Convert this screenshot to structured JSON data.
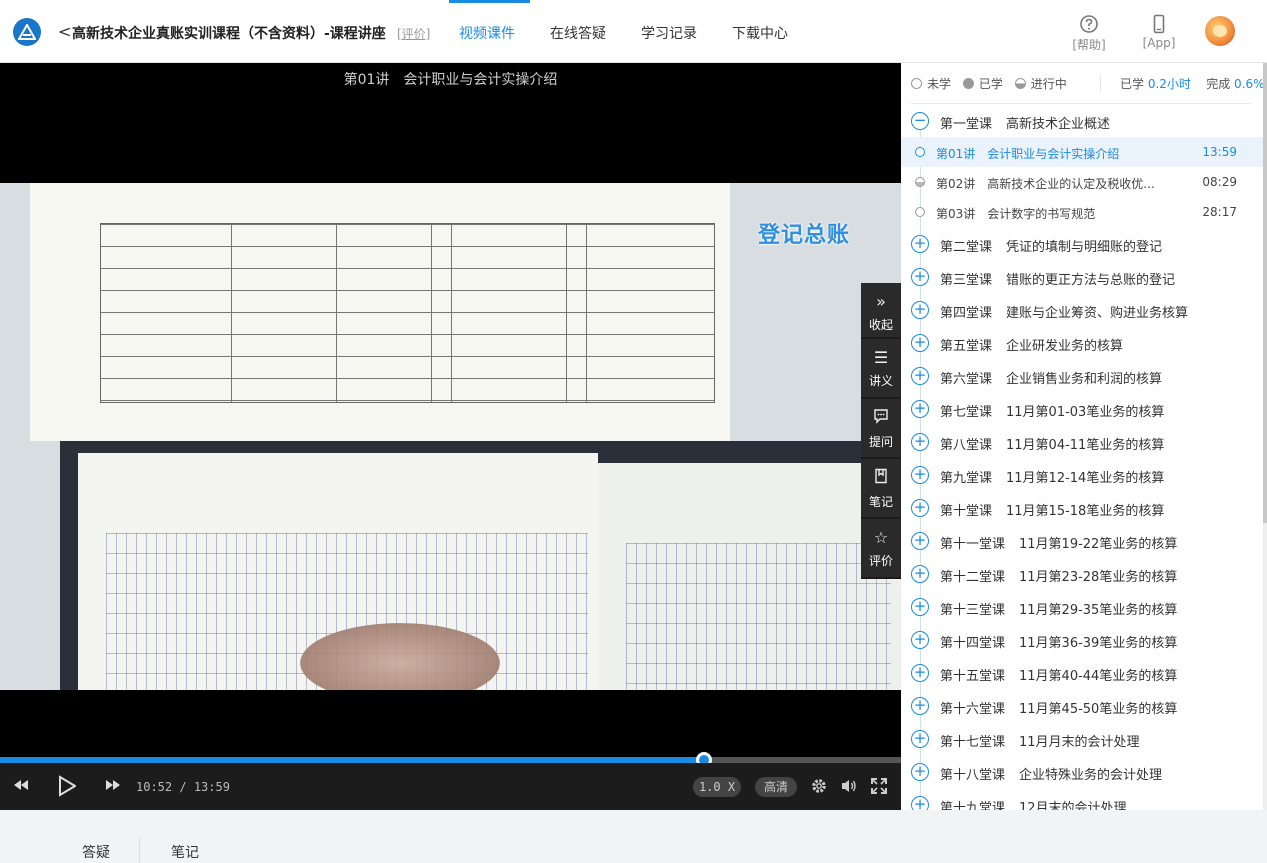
{
  "header": {
    "back_glyph": "<",
    "course_title": "高新技术企业真账实训课程（不含资料）-课程讲座",
    "review_link": "[评价]",
    "nav_tabs": [
      "视频课件",
      "在线答疑",
      "学习记录",
      "下载中心"
    ],
    "active_tab": "视频课件",
    "help_label": "[帮助]",
    "app_label": "[App]",
    "accent_color": "#1a8be3"
  },
  "player": {
    "lecture_title": "第01讲　会计职业与会计实操介绍",
    "overlay_caption": "登记总账",
    "current_time": "10:52",
    "time_separator": "/",
    "total_time": "13:59",
    "progress_fraction": 0.7812,
    "speed": "1.0 X",
    "quality": "高清"
  },
  "tools": [
    "收起",
    "讲义",
    "提问",
    "笔记",
    "评价"
  ],
  "panel": {
    "legend": [
      "未学",
      "已学",
      "进行中"
    ],
    "studied_label": "已学",
    "studied_value": "0.2小时",
    "complete_label": "完成",
    "complete_value": "0.6%",
    "chapters": [
      {
        "num": "第一堂课",
        "title": "高新技术企业概述",
        "expanded": true
      },
      {
        "num": "第二堂课",
        "title": "凭证的填制与明细账的登记"
      },
      {
        "num": "第三堂课",
        "title": "错账的更正方法与总账的登记"
      },
      {
        "num": "第四堂课",
        "title": "建账与企业筹资、购进业务核算"
      },
      {
        "num": "第五堂课",
        "title": "企业研发业务的核算"
      },
      {
        "num": "第六堂课",
        "title": "企业销售业务和利润的核算"
      },
      {
        "num": "第七堂课",
        "title": "11月第01-03笔业务的核算"
      },
      {
        "num": "第八堂课",
        "title": "11月第04-11笔业务的核算"
      },
      {
        "num": "第九堂课",
        "title": "11月第12-14笔业务的核算"
      },
      {
        "num": "第十堂课",
        "title": "11月第15-18笔业务的核算"
      },
      {
        "num": "第十一堂课",
        "title": "11月第19-22笔业务的核算"
      },
      {
        "num": "第十二堂课",
        "title": "11月第23-28笔业务的核算"
      },
      {
        "num": "第十三堂课",
        "title": "11月第29-35笔业务的核算"
      },
      {
        "num": "第十四堂课",
        "title": "11月第36-39笔业务的核算"
      },
      {
        "num": "第十五堂课",
        "title": "11月第40-44笔业务的核算"
      },
      {
        "num": "第十六堂课",
        "title": "11月第45-50笔业务的核算"
      },
      {
        "num": "第十七堂课",
        "title": "11月月末的会计处理"
      },
      {
        "num": "第十八堂课",
        "title": "企业特殊业务的会计处理"
      },
      {
        "num": "第十九堂课",
        "title": "12月末的会计处理"
      }
    ],
    "lectures": [
      {
        "num": "第01讲",
        "title": "会计职业与会计实操介绍",
        "duration": "13:59",
        "state": "in-progress"
      },
      {
        "num": "第02讲",
        "title": "高新技术企业的认定及税收优...",
        "duration": "08:29",
        "state": "in-progress"
      },
      {
        "num": "第03讲",
        "title": "会计数字的书写规范",
        "duration": "28:17",
        "state": "unstudied"
      }
    ]
  },
  "bottom_tabs": [
    "答疑",
    "笔记"
  ]
}
